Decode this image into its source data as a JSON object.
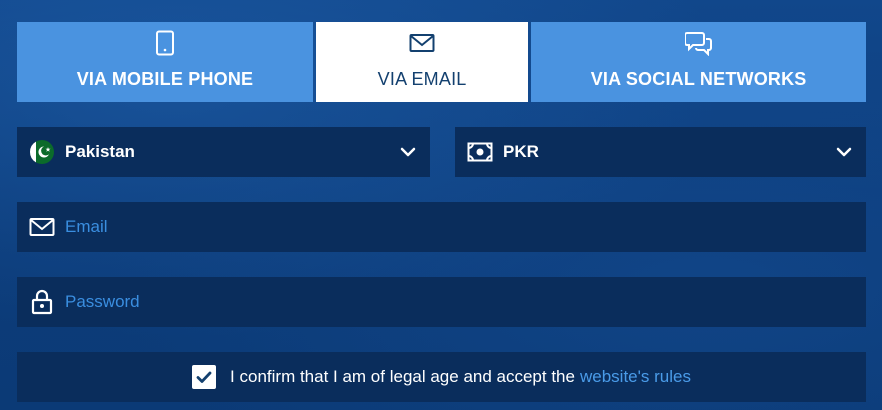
{
  "tabs": [
    {
      "label": "VIA MOBILE PHONE",
      "icon": "mobile-phone-icon",
      "active": false
    },
    {
      "label": "VIA EMAIL",
      "icon": "envelope-icon",
      "active": true
    },
    {
      "label": "VIA SOCIAL NETWORKS",
      "icon": "chat-bubbles-icon",
      "active": false
    }
  ],
  "country_select": {
    "value": "Pakistan",
    "icon": "pakistan-flag-icon"
  },
  "currency_select": {
    "value": "PKR",
    "icon": "banknote-icon"
  },
  "email_field": {
    "placeholder": "Email",
    "value": "",
    "icon": "envelope-icon"
  },
  "password_field": {
    "placeholder": "Password",
    "value": "",
    "icon": "lock-icon"
  },
  "confirm": {
    "checked": true,
    "text": "I confirm that I am of legal age and accept the",
    "link_text": "website's rules"
  },
  "colors": {
    "tab_inactive": "#4a93e0",
    "tab_active": "#ffffff",
    "field_bg": "#0a2d5c",
    "page_bg": "#0d3f80",
    "placeholder": "#3a8ee0",
    "link": "#4a9be8"
  }
}
